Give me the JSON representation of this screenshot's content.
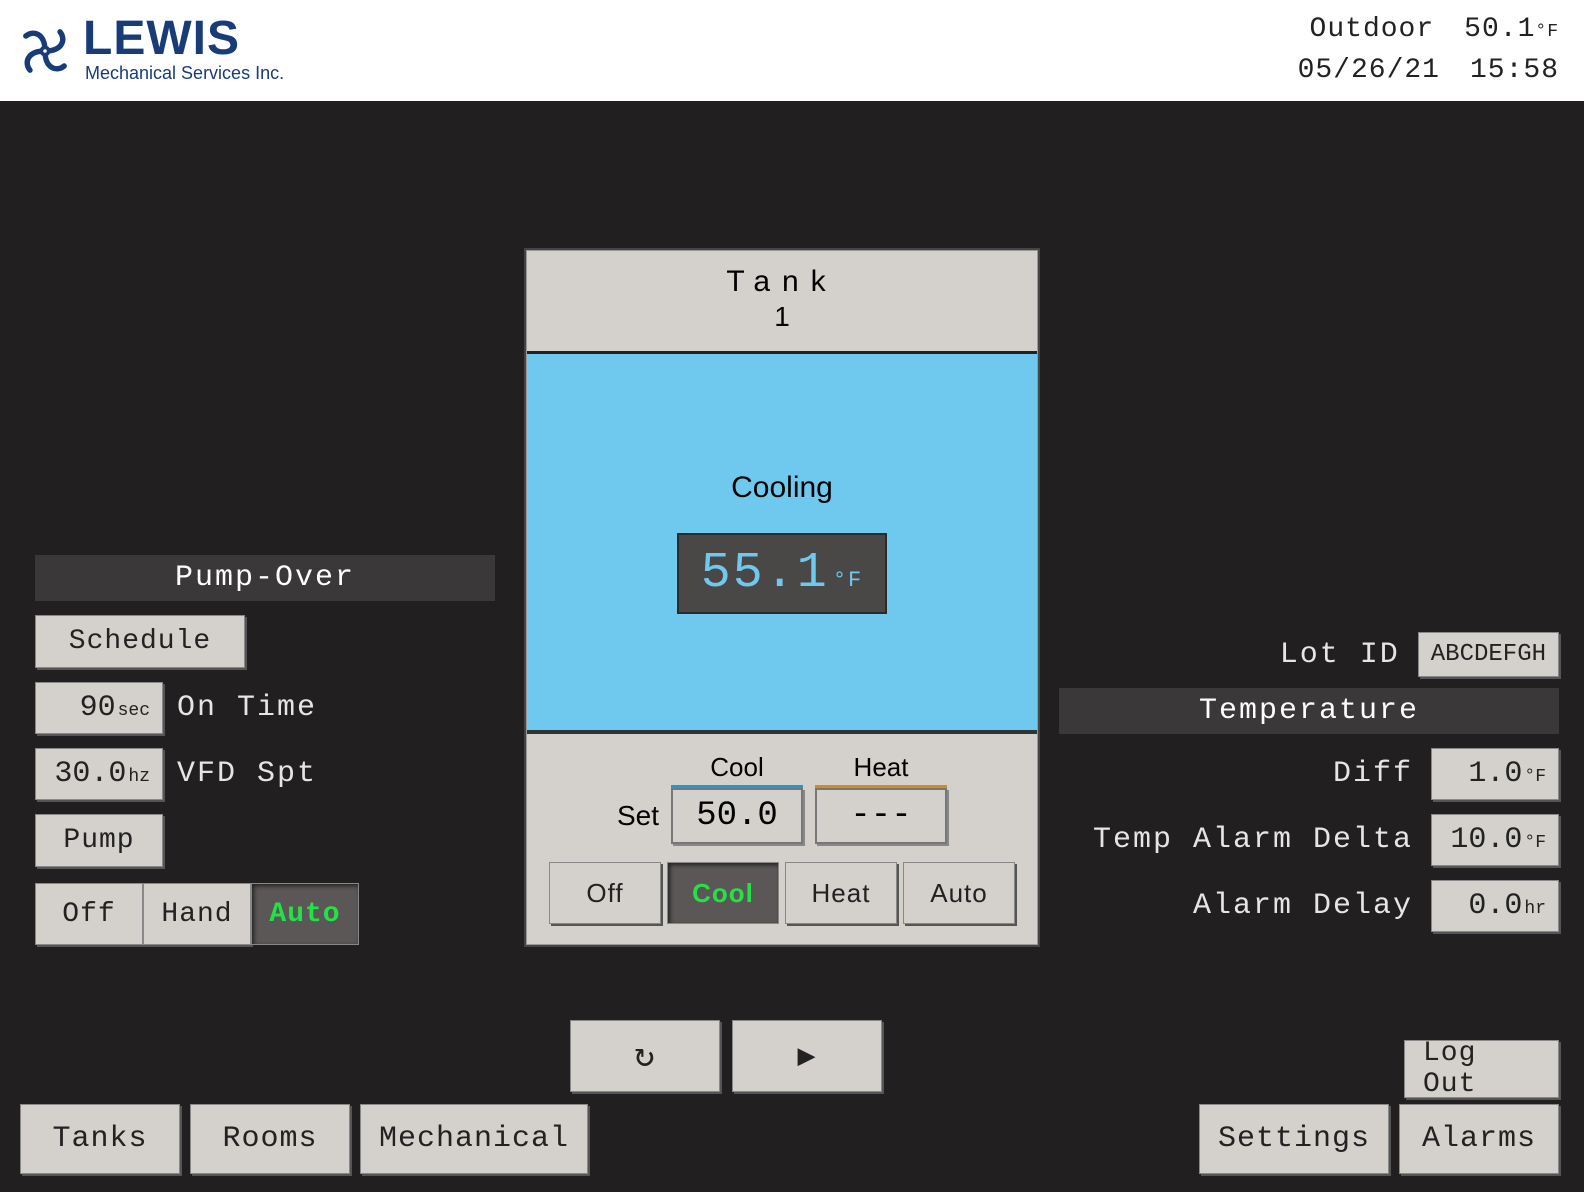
{
  "header": {
    "logo_title": "LEWIS",
    "logo_sub": "Mechanical Services Inc.",
    "outdoor_label": "Outdoor",
    "outdoor_value": "50.1",
    "date": "05/26/21",
    "time": "15:58"
  },
  "pump_over": {
    "title": "Pump-Over",
    "schedule_btn": "Schedule",
    "on_time_value": "90",
    "on_time_unit": "sec",
    "on_time_label": "On Time",
    "vfd_value": "30.0",
    "vfd_unit": "hz",
    "vfd_label": "VFD Spt",
    "pump_btn": "Pump",
    "modes": {
      "off": "Off",
      "hand": "Hand",
      "auto": "Auto"
    }
  },
  "tank": {
    "title_line1": "Tank",
    "title_line2": "1",
    "status": "Cooling",
    "temp": "55.1",
    "set_label": "Set",
    "cool_label": "Cool",
    "cool_value": "50.0",
    "heat_label": "Heat",
    "heat_value": "---",
    "modes": {
      "off": "Off",
      "cool": "Cool",
      "heat": "Heat",
      "auto": "Auto"
    }
  },
  "right": {
    "lot_label": "Lot ID",
    "lot_value": "ABCDEFGH",
    "temp_title": "Temperature",
    "diff_label": "Diff",
    "diff_value": "1.0",
    "alarm_delta_label": "Temp Alarm Delta",
    "alarm_delta_value": "10.0",
    "alarm_delay_label": "Alarm Delay",
    "alarm_delay_value": "0.0",
    "alarm_delay_unit": "hr"
  },
  "nav": {
    "logout": "Log Out",
    "tanks": "Tanks",
    "rooms": "Rooms",
    "mechanical": "Mechanical",
    "settings": "Settings",
    "alarms": "Alarms"
  }
}
